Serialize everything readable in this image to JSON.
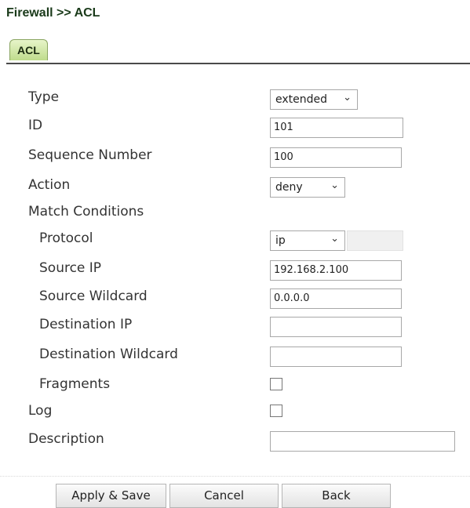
{
  "breadcrumb": "Firewall >> ACL",
  "tab_label": "ACL",
  "fields": {
    "type": {
      "label": "Type",
      "value": "extended"
    },
    "id": {
      "label": "ID",
      "value": "101"
    },
    "seq": {
      "label": "Sequence Number",
      "value": "100"
    },
    "action": {
      "label": "Action",
      "value": "deny"
    },
    "match": {
      "label": "Match Conditions"
    },
    "protocol": {
      "label": "Protocol",
      "value": "ip"
    },
    "src_ip": {
      "label": "Source IP",
      "value": "192.168.2.100"
    },
    "src_wild": {
      "label": "Source Wildcard",
      "value": "0.0.0.0"
    },
    "dst_ip": {
      "label": "Destination IP",
      "value": ""
    },
    "dst_wild": {
      "label": "Destination Wildcard",
      "value": ""
    },
    "fragments": {
      "label": "Fragments",
      "checked": false
    },
    "log": {
      "label": "Log",
      "checked": false
    },
    "description": {
      "label": "Description",
      "value": ""
    }
  },
  "buttons": {
    "apply": "Apply & Save",
    "cancel": "Cancel",
    "back": "Back"
  },
  "icons": {
    "dropdown": "chevron-down-icon"
  }
}
